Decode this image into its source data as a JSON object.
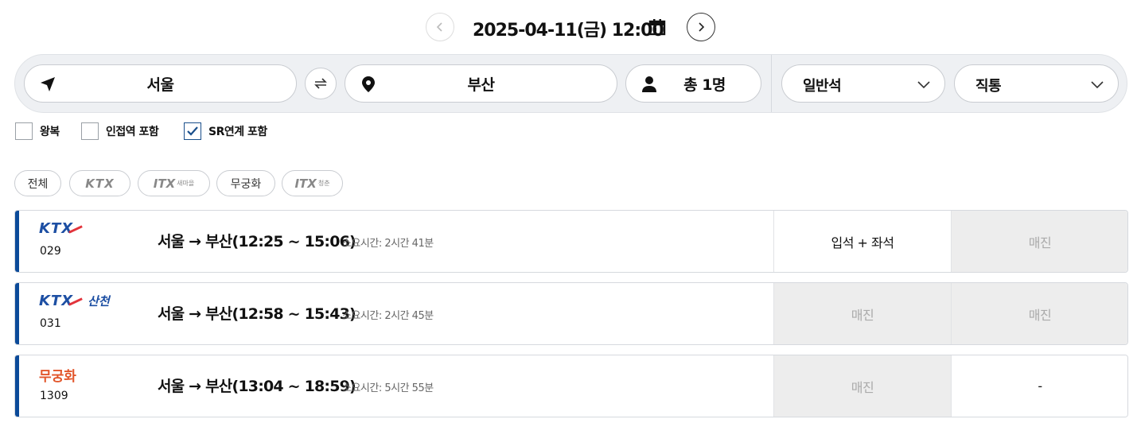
{
  "date_nav": {
    "date_text": "2025-04-11(금) 12:00"
  },
  "search": {
    "departure": "서울",
    "arrival": "부산",
    "passengers": "총 1명",
    "seat_class": "일반석",
    "route_type": "직통"
  },
  "options": [
    {
      "label": "왕복",
      "checked": false
    },
    {
      "label": "인접역 포함",
      "checked": false
    },
    {
      "label": "SR연계 포함",
      "checked": true
    }
  ],
  "filters": {
    "all": "전체",
    "ktx": "KTX",
    "itx_saemaeul": "ITX",
    "itx_saemaeul_sub": "새마을",
    "mugunghwa": "무궁화",
    "itx_cheongchun": "ITX",
    "itx_cheongchun_sub": "청춘"
  },
  "results": [
    {
      "brand": "KTX",
      "brand_sub": "",
      "train_no": "029",
      "route": "서울 → 부산(12:25 ~ 15:06)",
      "duration": "소요시간: 2시간 41분",
      "seat1": "입석 + 좌석",
      "seat2": "매진"
    },
    {
      "brand": "KTX",
      "brand_sub": "산천",
      "train_no": "031",
      "route": "서울 → 부산(12:58 ~ 15:43)",
      "duration": "소요시간: 2시간 45분",
      "seat1": "매진",
      "seat2": "매진"
    },
    {
      "brand": "무궁화",
      "brand_sub": "",
      "train_no": "1309",
      "route": "서울 → 부산(13:04 ~ 18:59)",
      "duration": "소요시간: 5시간 55분",
      "seat1": "매진",
      "seat2": "-"
    }
  ],
  "colors": {
    "accent": "#0b4a99",
    "ktx_red": "#e2333b",
    "mugunghwa": "#e2562b"
  }
}
